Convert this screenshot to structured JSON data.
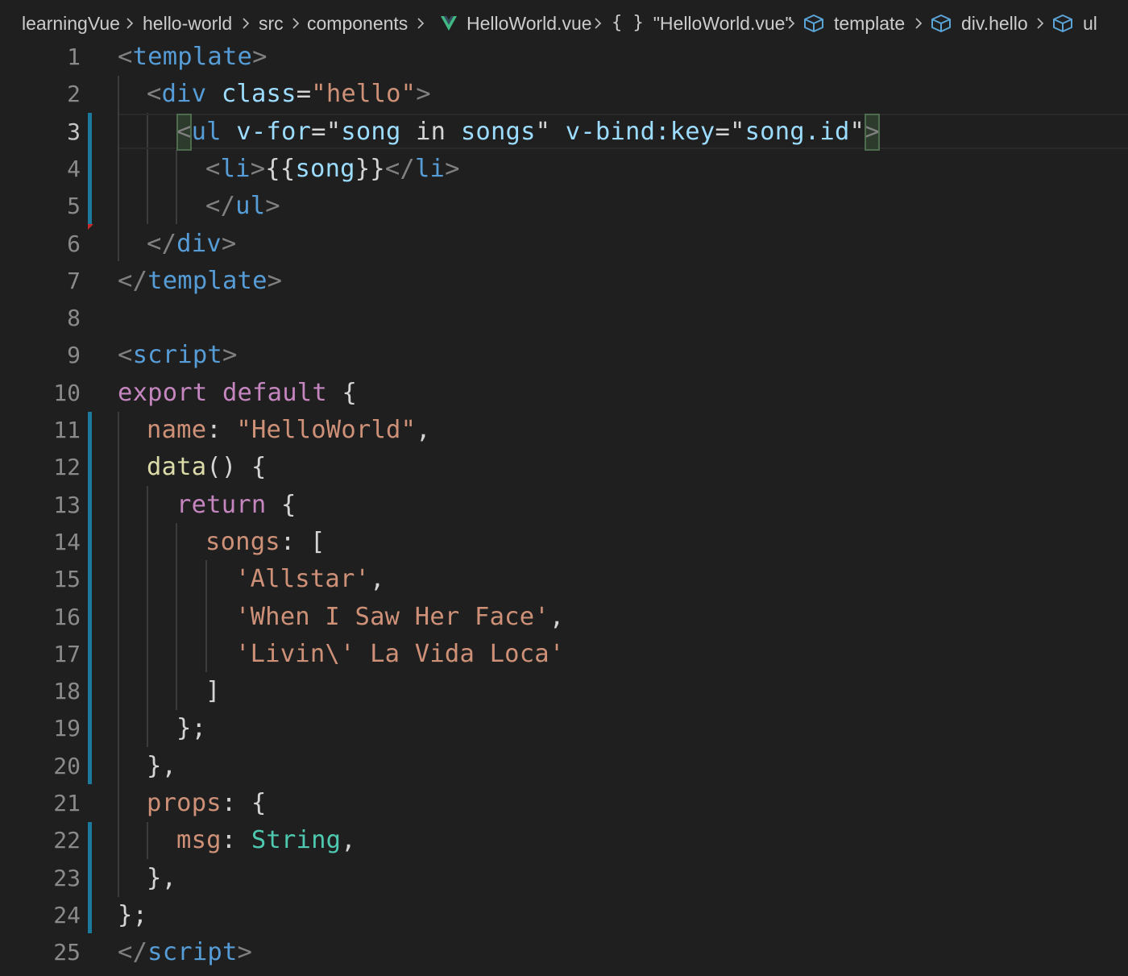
{
  "breadcrumb": {
    "items": [
      {
        "label": "learningVue",
        "icon": null
      },
      {
        "label": "hello-world",
        "icon": null
      },
      {
        "label": "src",
        "icon": null
      },
      {
        "label": "components",
        "icon": null
      },
      {
        "label": "HelloWorld.vue",
        "icon": "vue-logo-icon"
      },
      {
        "label": "\"HelloWorld.vue\"",
        "icon": "braces-icon"
      },
      {
        "label": "template",
        "icon": "cube-icon"
      },
      {
        "label": "div.hello",
        "icon": "cube-icon"
      },
      {
        "label": "ul",
        "icon": "cube-icon"
      }
    ],
    "vue_color": "#41b883",
    "cube_color": "#5ba4d8"
  },
  "editor": {
    "line_numbers": [
      "1",
      "2",
      "3",
      "4",
      "5",
      "6",
      "7",
      "8",
      "9",
      "10",
      "11",
      "12",
      "13",
      "14",
      "15",
      "16",
      "17",
      "18",
      "19",
      "20",
      "21",
      "22",
      "23",
      "24",
      "25"
    ],
    "active_line": "3",
    "tokens": {
      "l1": [
        "<",
        "template",
        ">"
      ],
      "l2": [
        "<",
        "div",
        " ",
        "class",
        "=",
        "\"hello\"",
        ">"
      ],
      "l3": [
        "<",
        "ul",
        " ",
        "v-for",
        "=",
        "\"",
        "song",
        " in ",
        "songs",
        "\"",
        " ",
        "v-bind:key",
        "=",
        "\"",
        "song.id",
        "\"",
        ">"
      ],
      "l4": [
        "<",
        "li",
        ">",
        "{{",
        "song",
        "}}",
        "</",
        "li",
        ">"
      ],
      "l5": [
        "</",
        "ul",
        ">"
      ],
      "l6": [
        "</",
        "div",
        ">"
      ],
      "l7": [
        "</",
        "template",
        ">"
      ],
      "l9": [
        "<",
        "script",
        ">"
      ],
      "l10": [
        "export",
        " ",
        "default",
        " {"
      ],
      "l11": [
        "name",
        ": ",
        "\"HelloWorld\"",
        ","
      ],
      "l12": [
        "data",
        "() {"
      ],
      "l13": [
        "return",
        " {"
      ],
      "l14": [
        "songs",
        ": ["
      ],
      "l15": [
        "'Allstar'",
        ","
      ],
      "l16": [
        "'When I Saw Her Face'",
        ","
      ],
      "l17": [
        "'Livin\\' La Vida Loca'"
      ],
      "l18": [
        "]"
      ],
      "l19": [
        "};"
      ],
      "l20": [
        "},"
      ],
      "l21": [
        "props",
        ": {"
      ],
      "l22": [
        "msg",
        ": ",
        "String",
        ","
      ],
      "l23": [
        "},"
      ],
      "l24": [
        "};"
      ],
      "l25": [
        "</",
        "script",
        ">"
      ]
    },
    "colors": {
      "background": "#1f1f1f",
      "tag": "#569cd6",
      "tag_punct": "#808080",
      "attribute": "#9cdcfe",
      "string": "#ce9178",
      "keyword": "#c586c0",
      "function": "#dcdcaa",
      "type": "#4ec9b0",
      "modified_gutter": "#1b7a9c"
    }
  }
}
